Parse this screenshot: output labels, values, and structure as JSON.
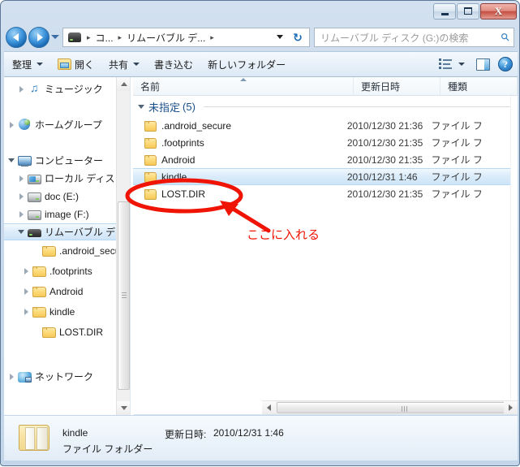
{
  "window": {
    "buttons": {
      "minimize": "minimize",
      "maximize": "maximize",
      "close": "X"
    }
  },
  "address_bar": {
    "back": "back",
    "forward": "forward",
    "history_dropdown": "recent-locations",
    "breadcrumb": [
      {
        "label": "コ...",
        "sep": "▸"
      },
      {
        "label": "リムーバブル デ...",
        "sep": "▸"
      }
    ],
    "crumb_drive_icon": "usb-drive-icon",
    "path_dropdown": "previous-locations",
    "refresh": "↻",
    "search": {
      "placeholder": "リムーバブル ディスク (G:)の検索",
      "value": "",
      "icon": "search-icon"
    }
  },
  "toolbar": {
    "organize": "整理",
    "open": "開く",
    "share": "共有",
    "burn": "書き込む",
    "new_folder": "新しいフォルダー",
    "view_options": "view-options",
    "preview_pane": "preview-pane",
    "help": "?"
  },
  "sidebar": {
    "items": [
      {
        "label": "ミュージック",
        "icon": "music-icon",
        "indent": 16,
        "twisty": "closed",
        "selected": false
      },
      {
        "label": "ホームグループ",
        "icon": "homegroup-icon",
        "indent": 4,
        "twisty": "closed",
        "selected": false
      },
      {
        "label": "コンピューター",
        "icon": "computer-icon",
        "indent": 4,
        "twisty": "open",
        "selected": false
      },
      {
        "label": "ローカル ディス",
        "icon": "local-disk-icon",
        "indent": 16,
        "twisty": "closed",
        "selected": false
      },
      {
        "label": "doc (E:)",
        "icon": "drive-icon",
        "indent": 16,
        "twisty": "closed",
        "selected": false
      },
      {
        "label": "image (F:)",
        "icon": "drive-icon",
        "indent": 16,
        "twisty": "closed",
        "selected": false
      },
      {
        "label": "リムーバブル デ",
        "icon": "usb-drive-icon",
        "indent": 16,
        "twisty": "open",
        "selected": true
      },
      {
        "label": ".android_secu",
        "icon": "folder-icon",
        "indent": 34,
        "twisty": "none",
        "selected": false
      },
      {
        "label": ".footprints",
        "icon": "folder-icon",
        "indent": 34,
        "twisty": "closed",
        "selected": false
      },
      {
        "label": "Android",
        "icon": "folder-icon",
        "indent": 34,
        "twisty": "closed",
        "selected": false
      },
      {
        "label": "kindle",
        "icon": "folder-icon",
        "indent": 34,
        "twisty": "closed",
        "selected": false
      },
      {
        "label": "LOST.DIR",
        "icon": "folder-icon",
        "indent": 34,
        "twisty": "none",
        "selected": false
      },
      {
        "label": "ネットワーク",
        "icon": "network-icon",
        "indent": 4,
        "twisty": "closed",
        "selected": false
      }
    ]
  },
  "file_list": {
    "columns": {
      "name": "名前",
      "date": "更新日時",
      "type": "種類"
    },
    "group": {
      "label": "未指定",
      "count": "(5)"
    },
    "rows": [
      {
        "name": ".android_secure",
        "date": "2010/12/30 21:36",
        "type": "ファイル フ",
        "selected": false
      },
      {
        "name": ".footprints",
        "date": "2010/12/30 21:35",
        "type": "ファイル フ",
        "selected": false
      },
      {
        "name": "Android",
        "date": "2010/12/30 21:35",
        "type": "ファイル フ",
        "selected": false
      },
      {
        "name": "kindle",
        "date": "2010/12/31 1:46",
        "type": "ファイル フ",
        "selected": true
      },
      {
        "name": "LOST.DIR",
        "date": "2010/12/30 21:35",
        "type": "ファイル フ",
        "selected": false
      }
    ]
  },
  "details_pane": {
    "name": "kindle",
    "type": "ファイル フォルダー",
    "date_label": "更新日時:",
    "date_value": "2010/12/31 1:46"
  },
  "annotation": {
    "text": "ここに入れる",
    "color": "#f01405",
    "ellipse": "highlight-ellipse-around-kindle-row",
    "arrow": "arrow-pointing-to-kindle-row"
  }
}
